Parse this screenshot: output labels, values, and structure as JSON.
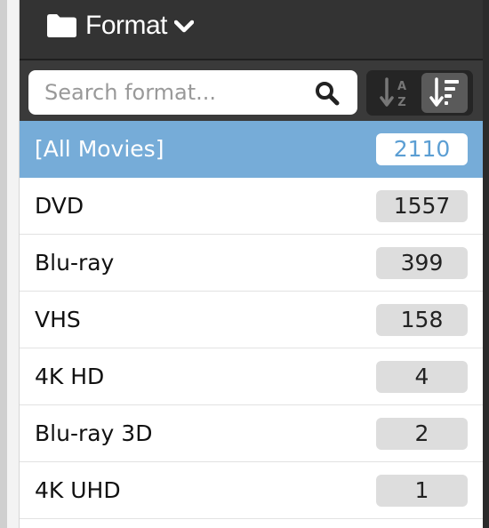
{
  "header": {
    "title": "Format",
    "folder_icon": "folder-icon",
    "chevron_icon": "chevron-down-icon"
  },
  "search": {
    "placeholder": "Search format...",
    "value": "",
    "icon": "search-icon"
  },
  "sort": {
    "alpha_icon": "sort-alpha-icon",
    "count_icon": "sort-count-icon",
    "alpha_letters": [
      "A",
      "Z"
    ],
    "active": "count"
  },
  "colors": {
    "header_bg": "#333333",
    "toolbar_bg": "#3a3a3a",
    "selected_bg": "#76acd8",
    "selected_count_text": "#5b9ed3",
    "count_badge_bg": "#dddddd"
  },
  "list": {
    "items": [
      {
        "label": "[All Movies]",
        "count": "2110",
        "selected": true
      },
      {
        "label": "DVD",
        "count": "1557",
        "selected": false
      },
      {
        "label": "Blu-ray",
        "count": "399",
        "selected": false
      },
      {
        "label": "VHS",
        "count": "158",
        "selected": false
      },
      {
        "label": "4K HD",
        "count": "4",
        "selected": false
      },
      {
        "label": "Blu-ray 3D",
        "count": "2",
        "selected": false
      },
      {
        "label": "4K UHD",
        "count": "1",
        "selected": false
      }
    ]
  }
}
